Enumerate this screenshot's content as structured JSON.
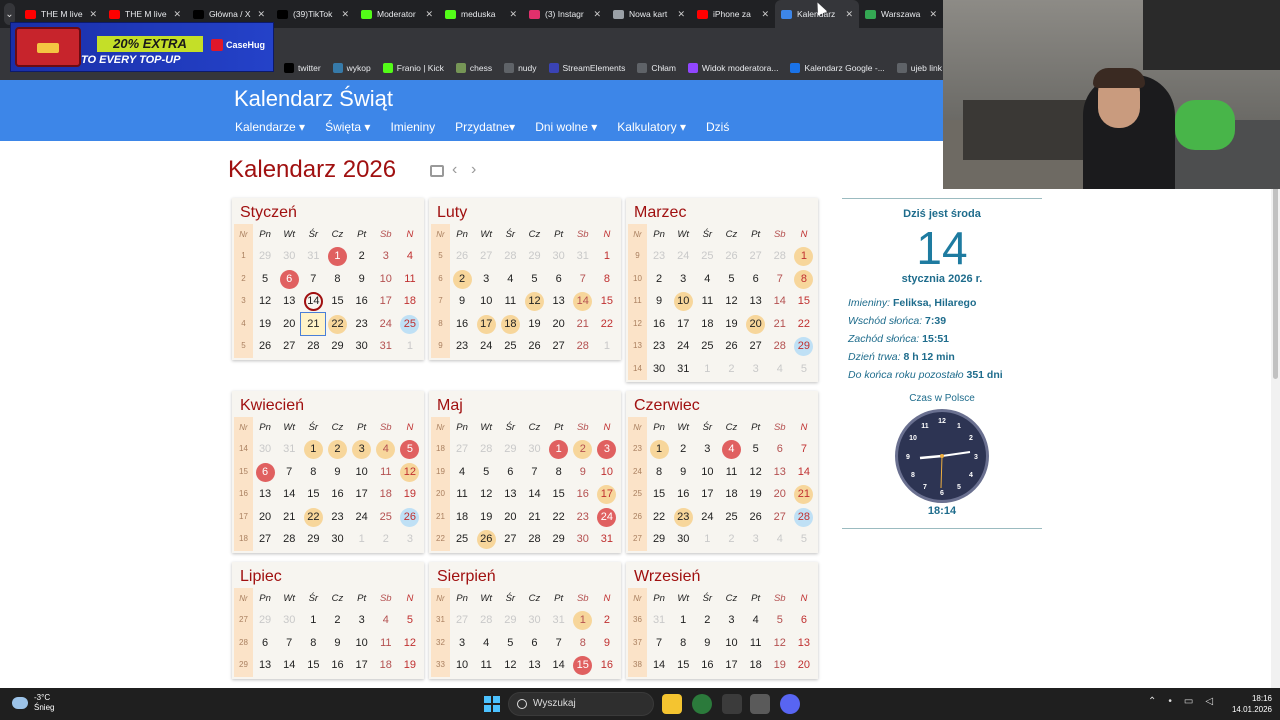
{
  "browser": {
    "tabs": [
      {
        "title": "THE M live",
        "color": "#ff0000",
        "icon": "youtube-icon"
      },
      {
        "title": "THE M live",
        "color": "#ff0000",
        "icon": "youtube-icon"
      },
      {
        "title": "Główna / X",
        "color": "#000000",
        "icon": "x-icon"
      },
      {
        "title": "(39)TikTok",
        "color": "#000000",
        "icon": "tiktok-icon"
      },
      {
        "title": "Moderator",
        "color": "#53fc18",
        "icon": "kick-icon"
      },
      {
        "title": "meduska",
        "color": "#53fc18",
        "icon": "kick-icon"
      },
      {
        "title": "(3) Instagr",
        "color": "#e1306c",
        "icon": "instagram-icon"
      },
      {
        "title": "Nowa kart",
        "color": "#9aa0a6",
        "icon": "chrome-icon"
      },
      {
        "title": "iPhone za",
        "color": "#ff0000",
        "icon": "youtube-icon"
      },
      {
        "title": "Kalendarz",
        "color": "#3d86e8",
        "icon": "calendar-icon",
        "active": true
      },
      {
        "title": "Warszawa",
        "color": "#34a853",
        "icon": "maps-icon"
      }
    ],
    "bookmarks": [
      {
        "label": "twitter",
        "color": "#000000"
      },
      {
        "label": "wykop",
        "color": "#367aa9"
      },
      {
        "label": "Franio | Kick",
        "color": "#53fc18"
      },
      {
        "label": "chess",
        "color": "#769656"
      },
      {
        "label": "nudy",
        "color": "#5f6368"
      },
      {
        "label": "StreamElements",
        "color": "#3a43b5"
      },
      {
        "label": "Chłam",
        "color": "#5f6368"
      },
      {
        "label": "Widok moderatora...",
        "color": "#9146ff"
      },
      {
        "label": "Kalendarz Google -...",
        "color": "#1a73e8"
      },
      {
        "label": "ujeb link",
        "color": "#5f6368"
      }
    ]
  },
  "ad": {
    "line1": "20% EXTRA",
    "line2": "TO EVERY TOP-UP",
    "brand": "CaseHug"
  },
  "site": {
    "title": "Kalendarz Świąt",
    "nav": [
      "Kalendarze ▾",
      "Święta ▾",
      "Imieniny",
      "Przydatne▾",
      "Dni wolne ▾",
      "Kalkulatory ▾",
      "Dziś"
    ]
  },
  "page": {
    "title": "Kalendarz 2026"
  },
  "weekday_headers": [
    "Nr",
    "Pn",
    "Wt",
    "Śr",
    "Cz",
    "Pt",
    "Sb",
    "N"
  ],
  "months": [
    {
      "name": "Styczeń",
      "rows": [
        {
          "wk": "1",
          "d": [
            "29",
            "30",
            "31",
            "1",
            "2",
            "3",
            "4"
          ],
          "o": [
            1,
            1,
            1,
            0,
            0,
            0,
            0
          ],
          "m": {
            "3": "hol"
          }
        },
        {
          "wk": "2",
          "d": [
            "5",
            "6",
            "7",
            "8",
            "9",
            "10",
            "11"
          ],
          "m": {
            "1": "hol"
          }
        },
        {
          "wk": "3",
          "d": [
            "12",
            "13",
            "14",
            "15",
            "16",
            "17",
            "18"
          ],
          "m": {
            "2": "today"
          }
        },
        {
          "wk": "4",
          "d": [
            "19",
            "20",
            "21",
            "22",
            "23",
            "24",
            "25"
          ],
          "m": {
            "2": "sel",
            "3": "orng",
            "6": "blue"
          }
        },
        {
          "wk": "5",
          "d": [
            "26",
            "27",
            "28",
            "29",
            "30",
            "31",
            "1"
          ],
          "o": [
            0,
            0,
            0,
            0,
            0,
            0,
            1
          ]
        }
      ]
    },
    {
      "name": "Luty",
      "rows": [
        {
          "wk": "5",
          "d": [
            "26",
            "27",
            "28",
            "29",
            "30",
            "31",
            "1"
          ],
          "o": [
            1,
            1,
            1,
            1,
            1,
            1,
            0
          ]
        },
        {
          "wk": "6",
          "d": [
            "2",
            "3",
            "4",
            "5",
            "6",
            "7",
            "8"
          ],
          "m": {
            "0": "orng"
          }
        },
        {
          "wk": "7",
          "d": [
            "9",
            "10",
            "11",
            "12",
            "13",
            "14",
            "15"
          ],
          "m": {
            "3": "orng",
            "5": "orng"
          }
        },
        {
          "wk": "8",
          "d": [
            "16",
            "17",
            "18",
            "19",
            "20",
            "21",
            "22"
          ],
          "m": {
            "1": "orng",
            "2": "orng"
          }
        },
        {
          "wk": "9",
          "d": [
            "23",
            "24",
            "25",
            "26",
            "27",
            "28",
            "1"
          ],
          "o": [
            0,
            0,
            0,
            0,
            0,
            0,
            1
          ]
        }
      ]
    },
    {
      "name": "Marzec",
      "rows": [
        {
          "wk": "9",
          "d": [
            "23",
            "24",
            "25",
            "26",
            "27",
            "28",
            "1"
          ],
          "o": [
            1,
            1,
            1,
            1,
            1,
            1,
            0
          ],
          "m": {
            "6": "orng"
          }
        },
        {
          "wk": "10",
          "d": [
            "2",
            "3",
            "4",
            "5",
            "6",
            "7",
            "8"
          ],
          "m": {
            "6": "orng"
          }
        },
        {
          "wk": "11",
          "d": [
            "9",
            "10",
            "11",
            "12",
            "13",
            "14",
            "15"
          ],
          "m": {
            "1": "orng"
          }
        },
        {
          "wk": "12",
          "d": [
            "16",
            "17",
            "18",
            "19",
            "20",
            "21",
            "22"
          ],
          "m": {
            "4": "orng"
          }
        },
        {
          "wk": "13",
          "d": [
            "23",
            "24",
            "25",
            "26",
            "27",
            "28",
            "29"
          ],
          "m": {
            "6": "blue"
          }
        },
        {
          "wk": "14",
          "d": [
            "30",
            "31",
            "1",
            "2",
            "3",
            "4",
            "5"
          ],
          "o": [
            0,
            0,
            1,
            1,
            1,
            1,
            1
          ]
        }
      ]
    },
    {
      "name": "Kwiecień",
      "rows": [
        {
          "wk": "14",
          "d": [
            "30",
            "31",
            "1",
            "2",
            "3",
            "4",
            "5"
          ],
          "o": [
            1,
            1,
            0,
            0,
            0,
            0,
            0
          ],
          "m": {
            "2": "orng",
            "3": "orng",
            "4": "orng",
            "5": "orng",
            "6": "hol"
          }
        },
        {
          "wk": "15",
          "d": [
            "6",
            "7",
            "8",
            "9",
            "10",
            "11",
            "12"
          ],
          "m": {
            "0": "hol",
            "6": "orng"
          }
        },
        {
          "wk": "16",
          "d": [
            "13",
            "14",
            "15",
            "16",
            "17",
            "18",
            "19"
          ]
        },
        {
          "wk": "17",
          "d": [
            "20",
            "21",
            "22",
            "23",
            "24",
            "25",
            "26"
          ],
          "m": {
            "2": "orng",
            "6": "blue"
          }
        },
        {
          "wk": "18",
          "d": [
            "27",
            "28",
            "29",
            "30",
            "1",
            "2",
            "3"
          ],
          "o": [
            0,
            0,
            0,
            0,
            1,
            1,
            1
          ]
        }
      ]
    },
    {
      "name": "Maj",
      "rows": [
        {
          "wk": "18",
          "d": [
            "27",
            "28",
            "29",
            "30",
            "1",
            "2",
            "3"
          ],
          "o": [
            1,
            1,
            1,
            1,
            0,
            0,
            0
          ],
          "m": {
            "4": "hol",
            "5": "orng",
            "6": "hol"
          }
        },
        {
          "wk": "19",
          "d": [
            "4",
            "5",
            "6",
            "7",
            "8",
            "9",
            "10"
          ]
        },
        {
          "wk": "20",
          "d": [
            "11",
            "12",
            "13",
            "14",
            "15",
            "16",
            "17"
          ],
          "m": {
            "6": "orng"
          }
        },
        {
          "wk": "21",
          "d": [
            "18",
            "19",
            "20",
            "21",
            "22",
            "23",
            "24"
          ],
          "m": {
            "6": "hol"
          }
        },
        {
          "wk": "22",
          "d": [
            "25",
            "26",
            "27",
            "28",
            "29",
            "30",
            "31"
          ],
          "m": {
            "1": "orng"
          }
        }
      ]
    },
    {
      "name": "Czerwiec",
      "rows": [
        {
          "wk": "23",
          "d": [
            "1",
            "2",
            "3",
            "4",
            "5",
            "6",
            "7"
          ],
          "m": {
            "0": "orng",
            "3": "hol"
          }
        },
        {
          "wk": "24",
          "d": [
            "8",
            "9",
            "10",
            "11",
            "12",
            "13",
            "14"
          ]
        },
        {
          "wk": "25",
          "d": [
            "15",
            "16",
            "17",
            "18",
            "19",
            "20",
            "21"
          ],
          "m": {
            "6": "orng"
          }
        },
        {
          "wk": "26",
          "d": [
            "22",
            "23",
            "24",
            "25",
            "26",
            "27",
            "28"
          ],
          "m": {
            "1": "orng",
            "6": "blue"
          }
        },
        {
          "wk": "27",
          "d": [
            "29",
            "30",
            "1",
            "2",
            "3",
            "4",
            "5"
          ],
          "o": [
            0,
            0,
            1,
            1,
            1,
            1,
            1
          ]
        }
      ]
    },
    {
      "name": "Lipiec",
      "rows": [
        {
          "wk": "27",
          "d": [
            "29",
            "30",
            "1",
            "2",
            "3",
            "4",
            "5"
          ],
          "o": [
            1,
            1,
            0,
            0,
            0,
            0,
            0
          ]
        },
        {
          "wk": "28",
          "d": [
            "6",
            "7",
            "8",
            "9",
            "10",
            "11",
            "12"
          ]
        },
        {
          "wk": "29",
          "d": [
            "13",
            "14",
            "15",
            "16",
            "17",
            "18",
            "19"
          ]
        }
      ]
    },
    {
      "name": "Sierpień",
      "rows": [
        {
          "wk": "31",
          "d": [
            "27",
            "28",
            "29",
            "30",
            "31",
            "1",
            "2"
          ],
          "o": [
            1,
            1,
            1,
            1,
            1,
            0,
            0
          ],
          "m": {
            "5": "orng"
          }
        },
        {
          "wk": "32",
          "d": [
            "3",
            "4",
            "5",
            "6",
            "7",
            "8",
            "9"
          ]
        },
        {
          "wk": "33",
          "d": [
            "10",
            "11",
            "12",
            "13",
            "14",
            "15",
            "16"
          ],
          "m": {
            "5": "hol"
          }
        }
      ]
    },
    {
      "name": "Wrzesień",
      "rows": [
        {
          "wk": "36",
          "d": [
            "31",
            "1",
            "2",
            "3",
            "4",
            "5",
            "6"
          ],
          "o": [
            1,
            0,
            0,
            0,
            0,
            0,
            0
          ]
        },
        {
          "wk": "37",
          "d": [
            "7",
            "8",
            "9",
            "10",
            "11",
            "12",
            "13"
          ]
        },
        {
          "wk": "38",
          "d": [
            "14",
            "15",
            "16",
            "17",
            "18",
            "19",
            "20"
          ]
        }
      ]
    }
  ],
  "sidebar": {
    "today_label": "Dziś jest środa",
    "day_number": "14",
    "date_text": "stycznia 2026 r.",
    "imieniny_label": "Imieniny:",
    "imieniny_value": "Feliksa, Hilarego",
    "sunrise_label": "Wschód słońca:",
    "sunrise_value": "7:39",
    "sunset_label": "Zachód słońca:",
    "sunset_value": "15:51",
    "daylen_label": "Dzień trwa:",
    "daylen_value": "8 h 12 min",
    "remain_label": "Do końca roku pozostało",
    "remain_value": "351 dni",
    "clock_title": "Czas w Polsce",
    "clock_time": "18:14"
  },
  "taskbar": {
    "temp": "-3°C",
    "weather": "Śnieg",
    "search_placeholder": "Wyszukaj",
    "time": "18:16",
    "date": "14.01.2026"
  }
}
